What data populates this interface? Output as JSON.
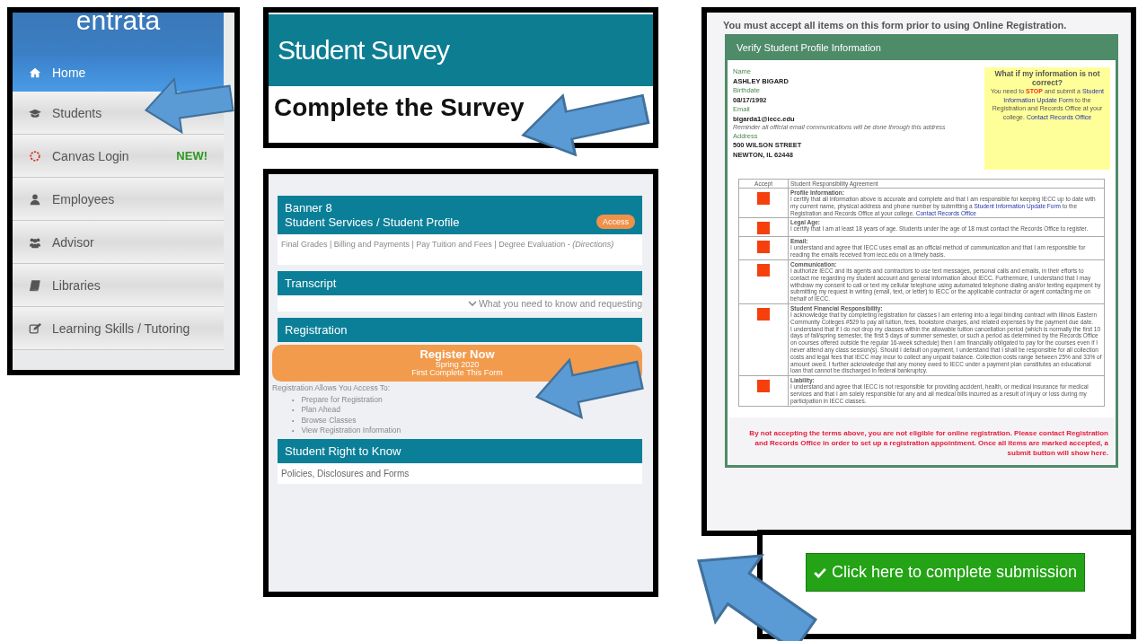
{
  "sidebar": {
    "logo": "entrata",
    "items": [
      {
        "label": "Home",
        "selected": true
      },
      {
        "label": "Students",
        "selected": false
      },
      {
        "label": "Canvas Login",
        "selected": false,
        "badge": "NEW!"
      },
      {
        "label": "Employees",
        "selected": false
      },
      {
        "label": "Advisor",
        "selected": false
      },
      {
        "label": "Libraries",
        "selected": false
      },
      {
        "label": "Learning Skills / Tutoring",
        "selected": false
      }
    ]
  },
  "survey": {
    "title": "Student Survey",
    "heading": "Complete the Survey"
  },
  "portal": {
    "banner": {
      "title_line_1": "Banner 8",
      "title_line_2": "Student Services / Student Profile",
      "badge": "Access",
      "links": "Final Grades | Billing and Payments | Pay Tuition and Fees | Degree Evaluation - ",
      "note": "(Directions)"
    },
    "transcript": {
      "title": "Transcript",
      "toggle": "What you need to know and requesting"
    },
    "registration": {
      "title": "Registration",
      "button_title": "Register Now",
      "button_term": "Spring 2020",
      "button_note": "First Complete This Form",
      "intro": "Registration Allows You Access To:",
      "bullet": "•",
      "items": [
        "Prepare for Registration",
        "Plan Ahead",
        "Browse Classes",
        "View Registration Information"
      ]
    },
    "right_to_know": {
      "title": "Student Right to Know",
      "text": "Policies, Disclosures and Forms"
    }
  },
  "form": {
    "notice": "You must accept all items on this form prior to using Online Registration.",
    "title": "Verify Student Profile Information",
    "fields": [
      {
        "label": "Name",
        "value": "ASHLEY BIGARD"
      },
      {
        "label": "Birthdate",
        "value": "08/17/1992"
      },
      {
        "label": "Email",
        "value": "bigarda1@iecc.edu",
        "hint": "Reminder all official email communications will be done through this address"
      },
      {
        "label": "Address",
        "value": "500 WILSON STREET",
        "value_2": "NEWTON, IL 62448"
      }
    ],
    "help": {
      "title": "What if my information is not correct?",
      "parts": [
        {
          "kind": "plain",
          "text": "You need to "
        },
        {
          "kind": "stop",
          "text": "STOP"
        },
        {
          "kind": "plain",
          "text": " and submit a "
        },
        {
          "kind": "link",
          "text": "Student Information Update Form"
        },
        {
          "kind": "plain",
          "text": " to the Registration and Records Office at your college. "
        },
        {
          "kind": "link",
          "text": "Contact Records Office"
        }
      ]
    },
    "columns": [
      "Accept",
      "Student Responsibility Agreement"
    ],
    "rows": [
      {
        "accepted": false,
        "title": "Profile Information:",
        "parts": [
          {
            "kind": "plain",
            "text": "I certify that all information above is accurate and complete and that I am responsible for keeping IECC up to date with my current name, physical address and phone number by submitting a "
          },
          {
            "kind": "link",
            "text": "Student Information Update Form"
          },
          {
            "kind": "plain",
            "text": " to the Registration and Records Office at your college. "
          },
          {
            "kind": "link",
            "text": "Contact Records Office"
          }
        ]
      },
      {
        "accepted": false,
        "title": "Legal Age:",
        "parts": [
          {
            "kind": "plain",
            "text": "I certify that I am at least 18 years of age. Students under the age of 18 must contact the Records Office to register."
          }
        ]
      },
      {
        "accepted": false,
        "title": "Email:",
        "parts": [
          {
            "kind": "plain",
            "text": "I understand and agree that IECC uses email as an official method of communication and that I am responsible for reading the emails received from iecc.edu on a timely basis."
          }
        ]
      },
      {
        "accepted": false,
        "title": "Communication:",
        "parts": [
          {
            "kind": "plain",
            "text": "I authorize IECC and its agents and contractors to use text messages, personal calls and emails, in their efforts to contact me regarding my student account and general information about IECC. Furthermore, I understand that I may withdraw my consent to call or text my cellular telephone using automated telephone dialing and/or texting equipment by submitting my request in writing (email, text, or letter) to IECC or the applicable contractor or agent contacting me on behalf of IECC."
          }
        ]
      },
      {
        "accepted": false,
        "title": "Student Financial Responsibility:",
        "parts": [
          {
            "kind": "plain",
            "text": "I acknowledge that by completing registration for classes I am entering into a legal binding contract with Illinois Eastern Community Colleges #529 to pay all tuition, fees, bookstore charges, and related expenses by the payment due date."
          },
          {
            "kind": "break",
            "text": "I understand that if I do not drop my classes within the allowable tuition cancellation period (which is normally the first 10 days of fall/spring semester, the first 5 days of summer semester, or such a period as determined by the Records Office on courses offered outside the regular 16-week schedule) then I am financially obligated to pay for the courses even if I never attend any class session(s). Should I default on payment, I understand that I shall be responsible for all collection costs and legal fees that IECC may incur to collect any unpaid balance. Collection costs range between 25% and 33% of amount owed. I further acknowledge that any money owed to IECC under a payment plan constitutes an educational loan that cannot be discharged in federal bankruptcy."
          }
        ]
      },
      {
        "accepted": false,
        "title": "Liability:",
        "parts": [
          {
            "kind": "plain",
            "text": "I understand and agree that IECC is not responsible for providing accident, health, or medical insurance for medical services and that I am solely responsible for any and all medical bills incurred as a result of injury or loss during my participation in IECC classes."
          }
        ]
      }
    ],
    "warning": "By not accepting the terms above, you are not eligible for online registration. Please contact Registration and Records Office in order to set up a registration appointment. Once all items are marked accepted, a submit button will show here."
  },
  "submit": {
    "label": "Click here to complete submission"
  }
}
